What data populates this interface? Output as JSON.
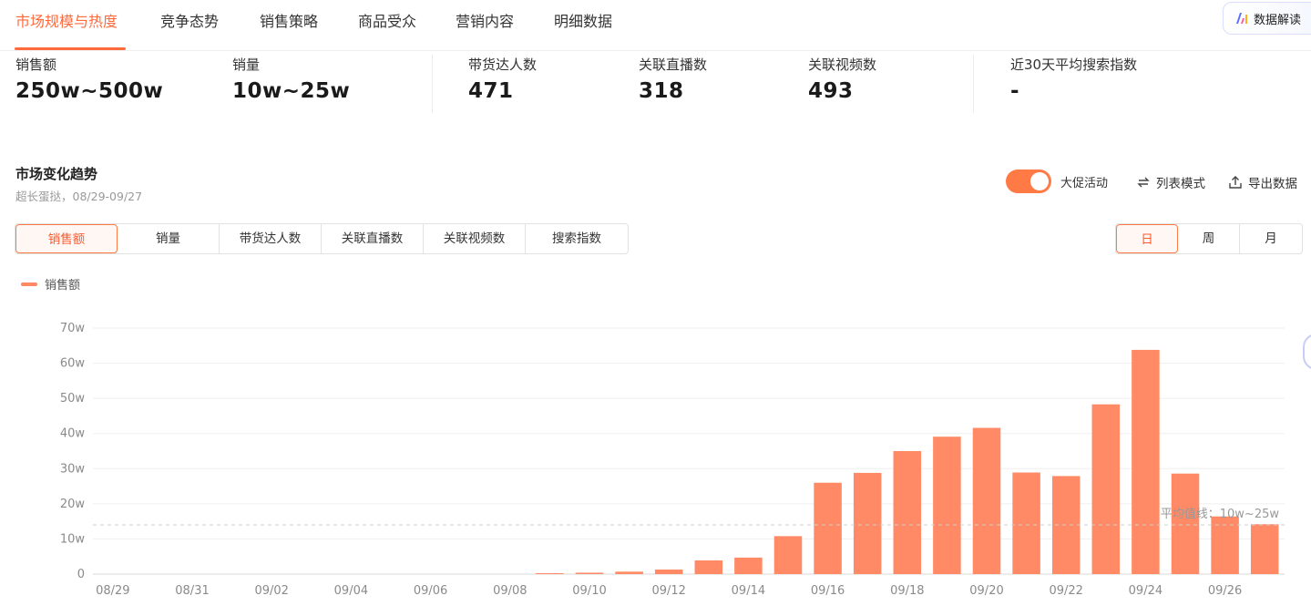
{
  "top_tabs": {
    "items": [
      "市场规模与热度",
      "竞争态势",
      "销售策略",
      "商品受众",
      "营销内容",
      "明细数据"
    ],
    "interpret_label": "数据解读"
  },
  "metrics": [
    {
      "label": "销售额",
      "value": "250w~500w"
    },
    {
      "label": "销量",
      "value": "10w~25w"
    },
    {
      "label": "带货达人数",
      "value": "471"
    },
    {
      "label": "关联直播数",
      "value": "318"
    },
    {
      "label": "关联视频数",
      "value": "493"
    },
    {
      "label": "近30天平均搜索指数",
      "value": "-"
    }
  ],
  "section": {
    "title": "市场变化趋势",
    "subtitle": "超长蛋挞，08/29-09/27"
  },
  "controls": {
    "promo_label": "大促活动",
    "promo_on": true,
    "list_mode_label": "列表模式",
    "export_label": "导出数据",
    "metric_tabs": [
      "销售额",
      "销量",
      "带货达人数",
      "关联直播数",
      "关联视频数",
      "搜索指数"
    ],
    "period_tabs": [
      "日",
      "周",
      "月"
    ]
  },
  "colors": {
    "accent": "#ff6a3d",
    "bar": "#ff8a65"
  },
  "chart_data": {
    "type": "bar",
    "title": "",
    "xlabel": "",
    "ylabel": "",
    "legend": "top-left",
    "grid": true,
    "ylim": [
      0,
      70
    ],
    "y_unit": "w",
    "y_ticks": [
      "0",
      "10w",
      "20w",
      "30w",
      "40w",
      "50w",
      "60w",
      "70w"
    ],
    "x_tick_labels": [
      "08/29",
      "08/31",
      "09/02",
      "09/04",
      "09/06",
      "09/08",
      "09/10",
      "09/12",
      "09/14",
      "09/16",
      "09/18",
      "09/20",
      "09/22",
      "09/24",
      "09/26"
    ],
    "categories": [
      "08/29",
      "08/30",
      "08/31",
      "09/01",
      "09/02",
      "09/03",
      "09/04",
      "09/05",
      "09/06",
      "09/07",
      "09/08",
      "09/09",
      "09/10",
      "09/11",
      "09/12",
      "09/13",
      "09/14",
      "09/15",
      "09/16",
      "09/17",
      "09/18",
      "09/19",
      "09/20",
      "09/21",
      "09/22",
      "09/23",
      "09/24",
      "09/25",
      "09/26",
      "09/27"
    ],
    "series": [
      {
        "name": "销售额",
        "values": [
          0,
          0,
          0,
          0,
          0,
          0,
          0,
          0,
          0,
          0,
          0,
          0.1,
          0.4,
          0.7,
          1.3,
          3.9,
          4.7,
          10.8,
          26,
          28.8,
          35,
          39.1,
          41.6,
          28.9,
          27.9,
          48.3,
          63.8,
          28.6,
          16.4,
          14.2
        ]
      }
    ],
    "average_line": {
      "value": 14,
      "label": "平均值线：10w~25w"
    }
  }
}
